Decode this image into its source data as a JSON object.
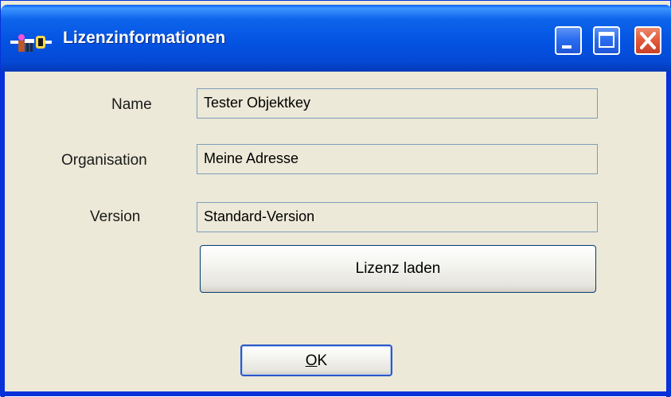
{
  "window": {
    "title": "Lizenzinformationen",
    "icon": "license-app-icon",
    "controls": [
      "minimize",
      "maximize",
      "close"
    ]
  },
  "form": {
    "fields": [
      {
        "label": "Name",
        "value": "Tester Objektkey"
      },
      {
        "label": "Organisation",
        "value": "Meine Adresse"
      },
      {
        "label": "Version",
        "value": "Standard-Version"
      }
    ]
  },
  "buttons": {
    "load_license": "Lizenz laden",
    "ok_mnemonic": "O",
    "ok_rest": "K"
  },
  "colors": {
    "titlebar_blue": "#0453e2",
    "window_bg": "#ece9d8",
    "close_red": "#e35c3c",
    "field_border": "#7f9db9"
  }
}
